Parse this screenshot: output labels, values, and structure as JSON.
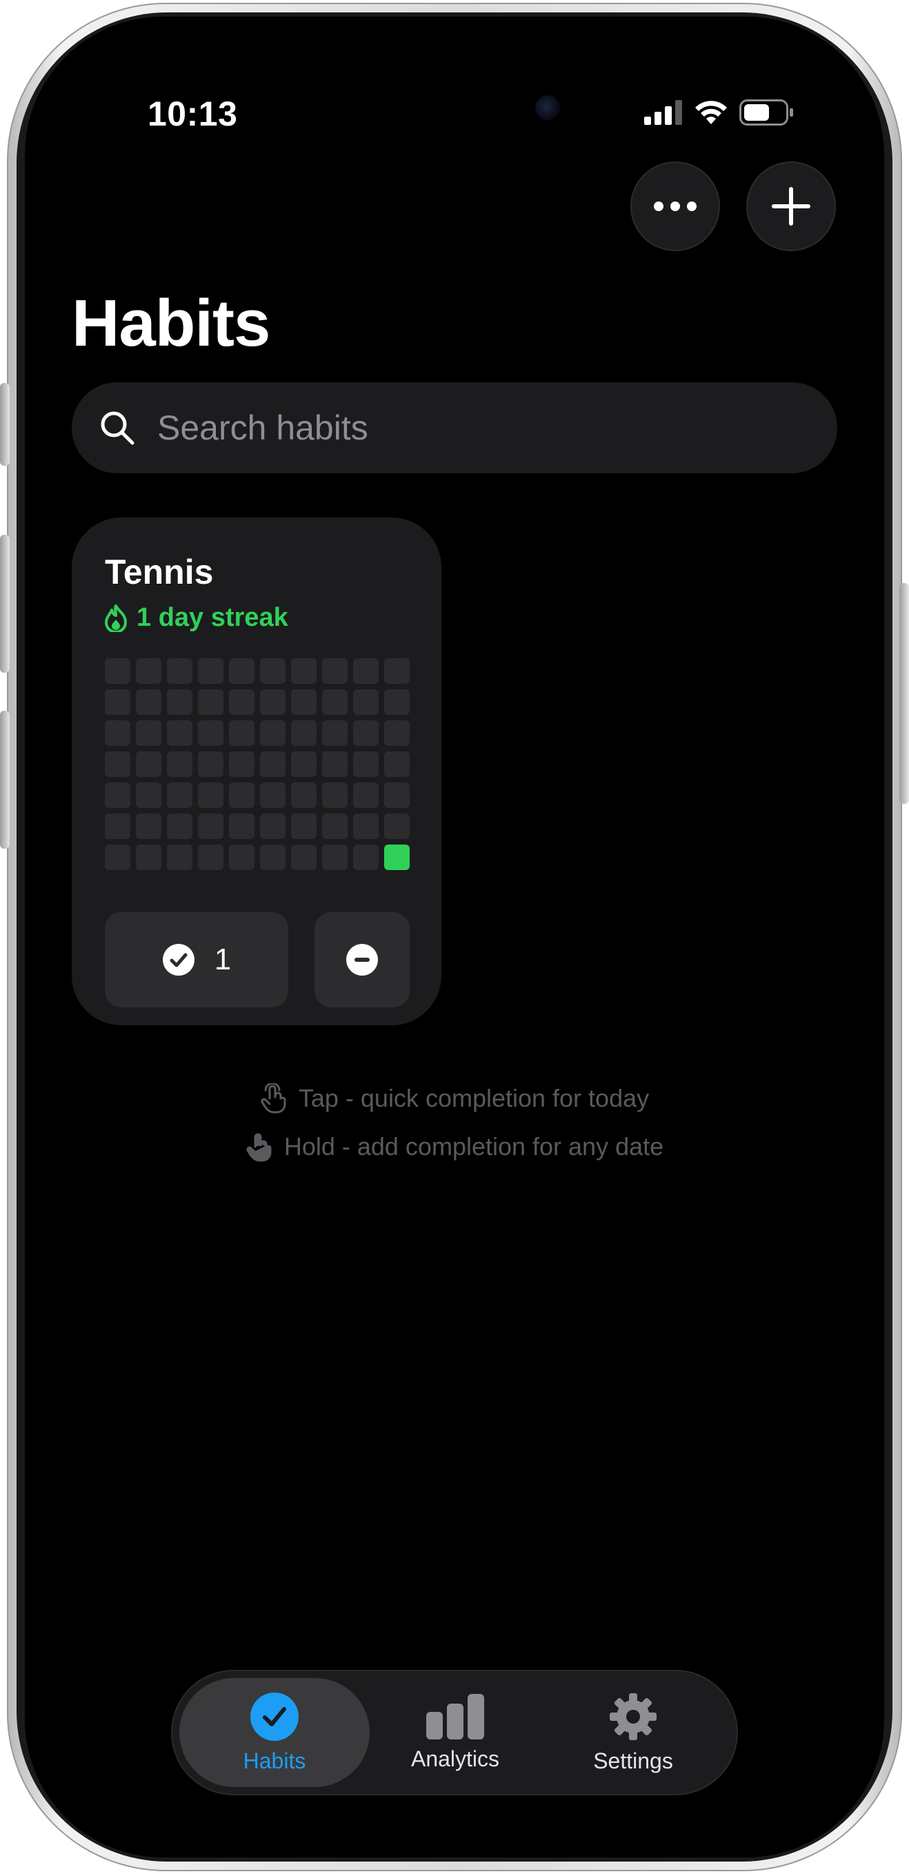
{
  "status_bar": {
    "time": "10:13",
    "icons": [
      "signal-icon",
      "wifi-icon",
      "battery-icon"
    ]
  },
  "header": {
    "more_icon": "ellipsis-icon",
    "add_icon": "plus-icon",
    "title": "Habits"
  },
  "search": {
    "placeholder": "Search habits",
    "value": ""
  },
  "habits": [
    {
      "name": "Tennis",
      "streak_text": "1 day streak",
      "completion_count": "1",
      "grid": {
        "rows": 7,
        "cols": 10,
        "completed_cells": [
          69
        ]
      }
    }
  ],
  "hints": {
    "tap": "Tap - quick completion for today",
    "hold": "Hold - add completion for any date"
  },
  "tab_bar": {
    "habits_label": "Habits",
    "analytics_label": "Analytics",
    "settings_label": "Settings",
    "active_tab": "Habits"
  },
  "colors": {
    "background": "#000000",
    "card": "#1c1c1e",
    "cell_empty": "#2c2c2e",
    "cell_done": "#30d158",
    "streak_green": "#30d158",
    "accent_blue": "#1c9ef5",
    "hint_gray": "#5a5a5e"
  }
}
